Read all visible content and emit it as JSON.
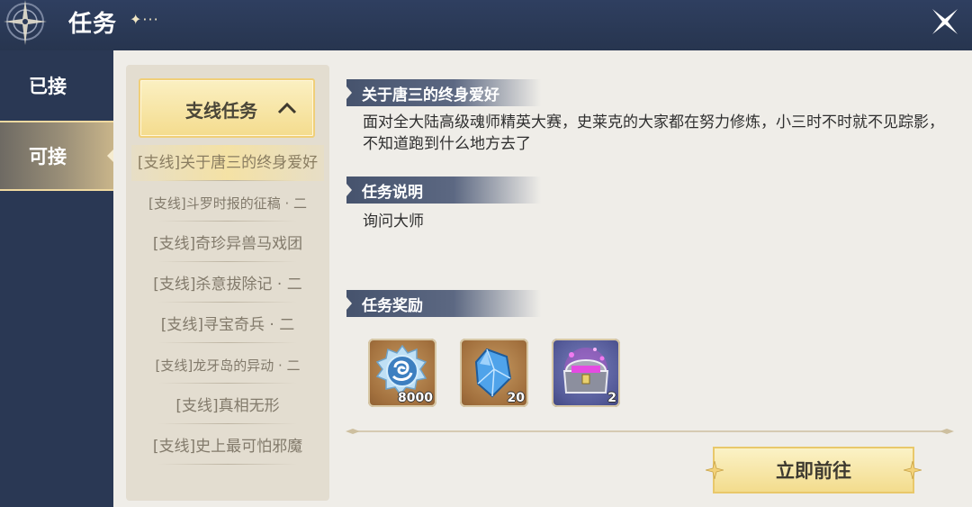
{
  "header": {
    "title": "任务",
    "title_deco": "✦···"
  },
  "nav": {
    "items": [
      {
        "label": "已接"
      },
      {
        "label": "可接"
      }
    ]
  },
  "quest_list": {
    "category_label": "支线任务",
    "items": [
      "[支线]关于唐三的终身爱好",
      "[支线]斗罗时报的征稿 · 二",
      "[支线]奇珍异兽马戏团",
      "[支线]杀意拔除记 · 二",
      "[支线]寻宝奇兵 · 二",
      "[支线]龙牙岛的异动 · 二",
      "[支线]真相无形",
      "[支线]史上最可怕邪魔"
    ]
  },
  "detail": {
    "quest_name": "关于唐三的终身爱好",
    "quest_desc": "面对全大陆高级魂师精英大赛，史莱克的大家都在努力修炼，小三时不时就不见踪影，不知道跑到什么地方去了",
    "desc_title": "任务说明",
    "desc_text": "询问大师",
    "reward_title": "任务奖励",
    "rewards": [
      {
        "icon": "soul-coin-icon",
        "count": "8000"
      },
      {
        "icon": "blue-crystal-icon",
        "count": "20"
      },
      {
        "icon": "treasure-chest-icon",
        "count": "2"
      }
    ]
  },
  "go_button": "立即前往"
}
